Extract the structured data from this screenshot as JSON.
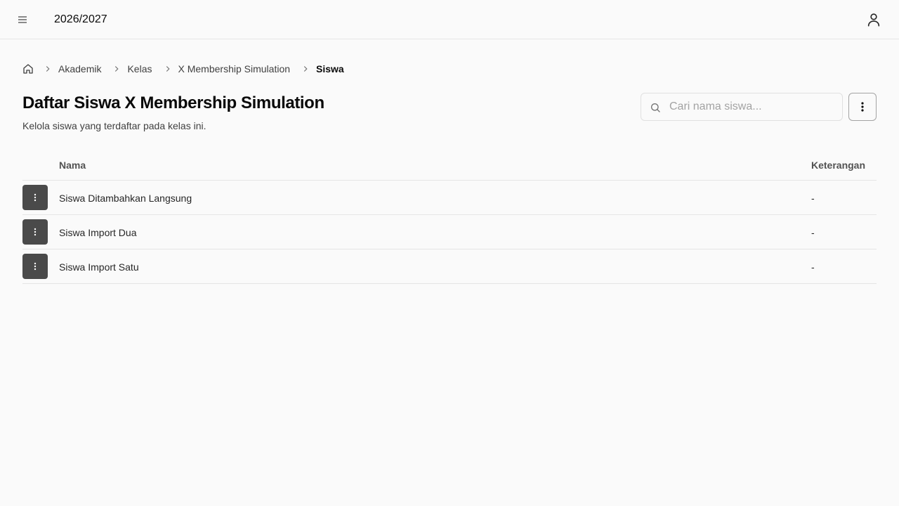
{
  "header": {
    "academic_year": "2026/2027"
  },
  "breadcrumb": {
    "items": [
      "Akademik",
      "Kelas",
      "X Membership Simulation"
    ],
    "current": "Siswa"
  },
  "page": {
    "title": "Daftar Siswa X Membership Simulation",
    "subtitle": "Kelola siswa yang terdaftar pada kelas ini."
  },
  "search": {
    "placeholder": "Cari nama siswa...",
    "value": ""
  },
  "table": {
    "columns": [
      "Nama",
      "Keterangan"
    ],
    "rows": [
      {
        "name": "Siswa Ditambahkan Langsung",
        "keterangan": "-"
      },
      {
        "name": "Siswa Import Dua",
        "keterangan": "-"
      },
      {
        "name": "Siswa Import Satu",
        "keterangan": "-"
      }
    ]
  },
  "icons": {
    "menu": "menu-icon",
    "user": "user-icon",
    "home": "home-icon",
    "chevron": "chevron-right-icon",
    "search": "search-icon",
    "more": "more-vertical-icon"
  },
  "colors": {
    "background": "#fafafa",
    "row_action": "#4a4a4a",
    "border": "#e5e5e5"
  }
}
